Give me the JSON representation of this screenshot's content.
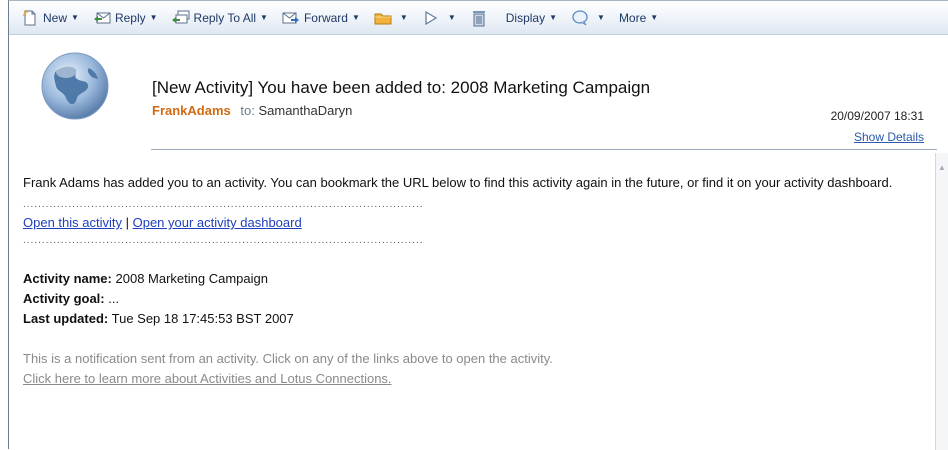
{
  "toolbar": {
    "new_label": "New",
    "reply_label": "Reply",
    "reply_all_label": "Reply To All",
    "forward_label": "Forward",
    "display_label": "Display",
    "more_label": "More",
    "icons": [
      "new-icon",
      "reply-icon",
      "reply-all-icon",
      "forward-icon",
      "folder-icon",
      "flag-icon",
      "trash-icon",
      "chat-icon"
    ]
  },
  "header": {
    "subject": "[New Activity] You have been added to: 2008 Marketing Campaign",
    "from": "FrankAdams",
    "to_label": "to:",
    "to": "SamanthaDaryn",
    "date": "20/09/2007 18:31",
    "show_details": "Show Details"
  },
  "body": {
    "intro": "Frank Adams has added you to an activity. You can bookmark the URL below to find this activity again in the future, or find it on your activity dashboard.",
    "dots": "................................................................................................................",
    "open_activity": "Open this activity",
    "link_separator": " | ",
    "open_dashboard": "Open your activity dashboard",
    "activity_name_label": "Activity name:",
    "activity_name": "2008 Marketing Campaign",
    "activity_goal_label": "Activity goal:",
    "activity_goal": "...",
    "last_updated_label": "Last updated:",
    "last_updated": "Tue Sep 18 17:45:53 BST 2007",
    "notice": "This is a notification sent from an activity. Click on any of the links above to open the activity.",
    "learn_more": "Click here to learn more about Activities and Lotus Connections."
  },
  "colors": {
    "sender": "#d26a12",
    "link": "#1f3fbf",
    "muted": "#8a8a8a"
  }
}
